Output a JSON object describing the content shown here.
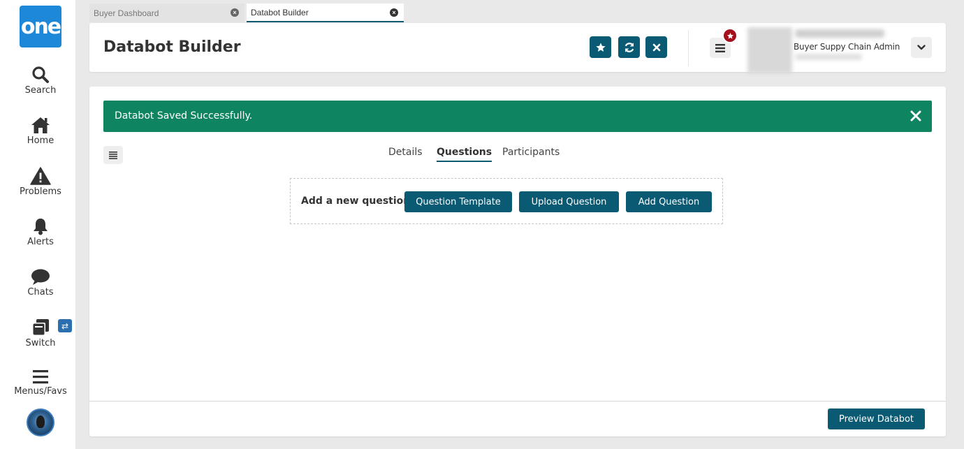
{
  "sidebar": {
    "logo_text": "one",
    "items": [
      {
        "label": "Search",
        "icon": "search-icon"
      },
      {
        "label": "Home",
        "icon": "home-icon"
      },
      {
        "label": "Problems",
        "icon": "warning-icon"
      },
      {
        "label": "Alerts",
        "icon": "bell-icon"
      },
      {
        "label": "Chats",
        "icon": "chat-icon"
      },
      {
        "label": "Switch",
        "icon": "switch-icon"
      },
      {
        "label": "Menus/Favs",
        "icon": "hamburger-icon"
      }
    ],
    "switch_badge": "⇄"
  },
  "tabs": [
    {
      "label": "Buyer Dashboard",
      "active": false
    },
    {
      "label": "Databot Builder",
      "active": true
    }
  ],
  "header": {
    "title": "Databot Builder",
    "user_role": "Buyer Suppy Chain Admin"
  },
  "alert": {
    "message": "Databot Saved Successfully."
  },
  "subtabs": [
    {
      "label": "Details",
      "active": false
    },
    {
      "label": "Questions",
      "active": true
    },
    {
      "label": "Participants",
      "active": false
    }
  ],
  "questions": {
    "add_label": "Add a new question",
    "template_button": "Question Template",
    "upload_button": "Upload Question",
    "add_button": "Add Question"
  },
  "footer": {
    "preview_button": "Preview Databot"
  },
  "colors": {
    "primary": "#0b5a74",
    "success": "#0f8461",
    "logo": "#1e88d8",
    "badge": "#a3121c"
  }
}
